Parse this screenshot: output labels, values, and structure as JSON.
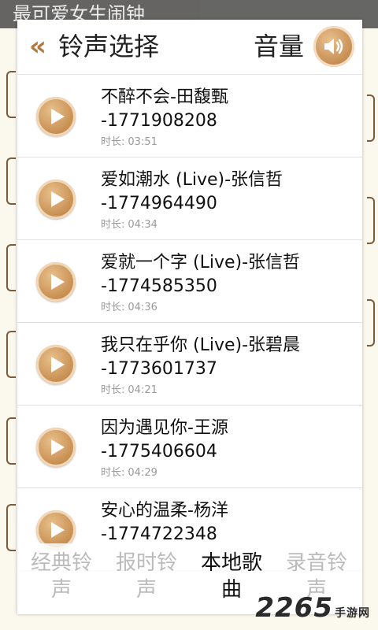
{
  "app_name": "最可爱女生闹钟",
  "header": {
    "back_icon": "double-chevron-left-icon",
    "title": "铃声选择",
    "volume_label": "音量",
    "volume_icon": "speaker-icon"
  },
  "songs": [
    {
      "name": "不醉不会-田馥甄",
      "id": "-1771908208",
      "duration_label": "时长:",
      "duration": "03:51"
    },
    {
      "name": "爱如潮水 (Live)-张信哲",
      "id": "-1774964490",
      "duration_label": "时长:",
      "duration": "04:34"
    },
    {
      "name": "爱就一个字 (Live)-张信哲",
      "id": "-1774585350",
      "duration_label": "时长:",
      "duration": "04:36"
    },
    {
      "name": "我只在乎你 (Live)-张碧晨",
      "id": "-1773601737",
      "duration_label": "时长:",
      "duration": "04:21"
    },
    {
      "name": "因为遇见你-王源",
      "id": "-1775406604",
      "duration_label": "时长:",
      "duration": "04:29"
    },
    {
      "name": "安心的温柔-杨洋",
      "id": "-1774722348",
      "duration_label": "",
      "duration": ""
    }
  ],
  "tabs": [
    {
      "label1": "经典铃",
      "label2": "声",
      "active": false
    },
    {
      "label1": "报时铃",
      "label2": "声",
      "active": false
    },
    {
      "label1": "本地歌",
      "label2": "曲",
      "active": true
    },
    {
      "label1": "录音铃",
      "label2": "声",
      "active": false
    }
  ],
  "watermark": {
    "text": "2265",
    "suffix": "手游网"
  },
  "colors": {
    "accent": "#c58b4d",
    "title": "#222222",
    "duration": "#9a9a9a"
  }
}
